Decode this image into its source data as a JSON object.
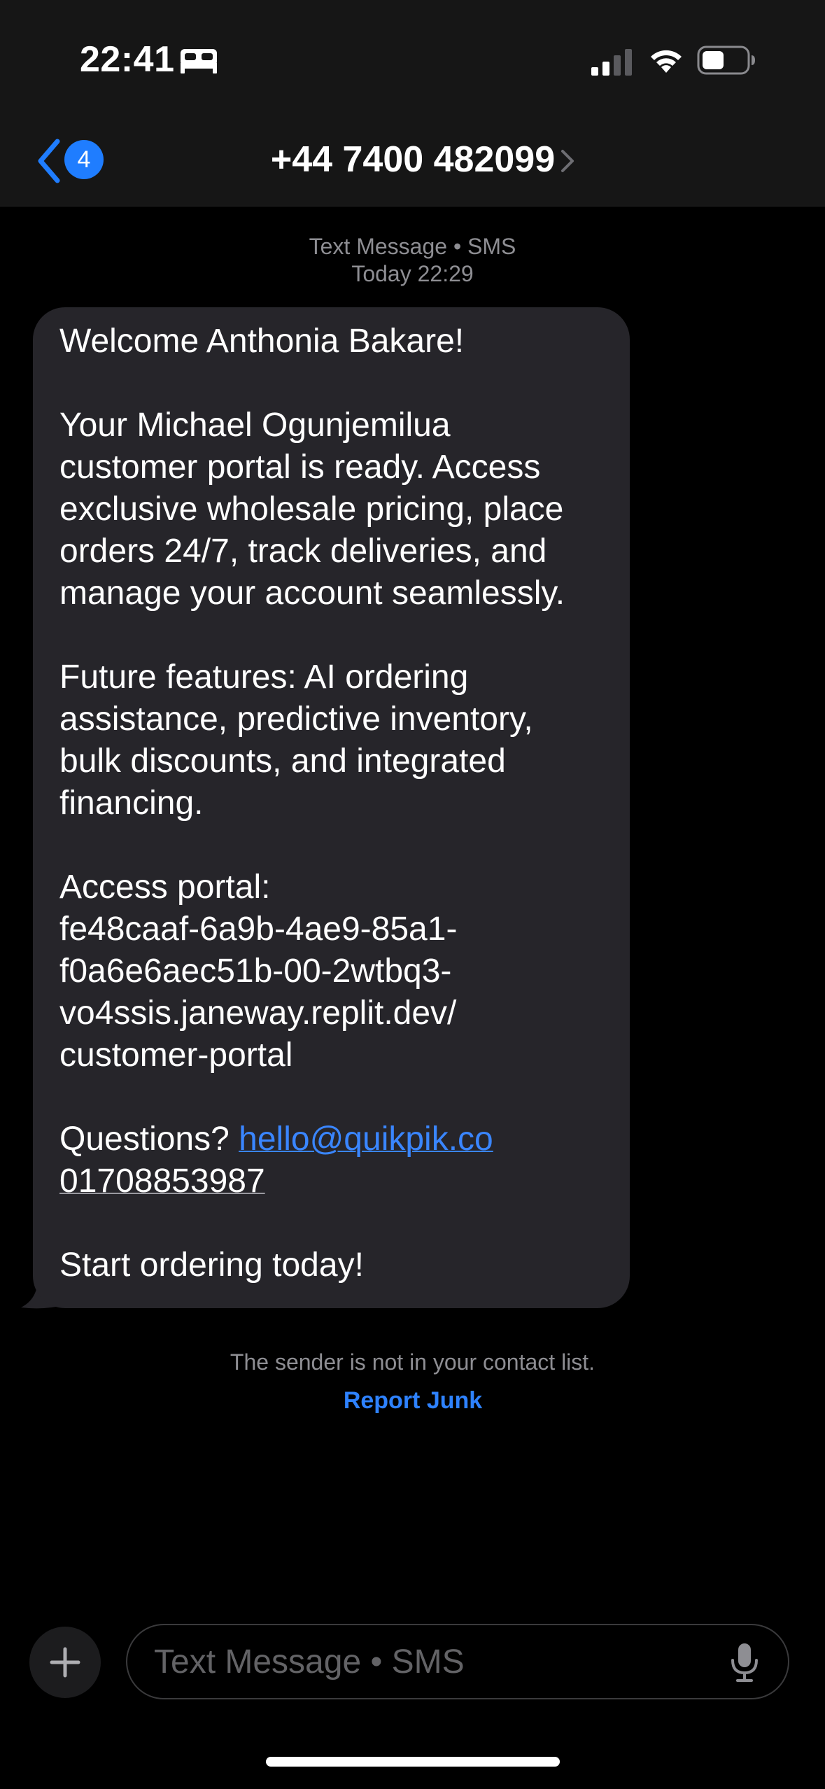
{
  "status_bar": {
    "time": "22:41",
    "focus_icon": "bed-icon",
    "signal_icon": "cellular-signal-icon",
    "wifi_icon": "wifi-icon",
    "battery_icon": "battery-icon"
  },
  "header": {
    "back_badge_count": "4",
    "contact_title": "+44 7400 482099",
    "accent_color": "#1f7dff"
  },
  "conversation": {
    "channel_label": "Text Message • SMS",
    "timestamp": "Today 22:29",
    "message": {
      "line_1": "Welcome Anthonia Bakare!",
      "line_2": "Your Michael Ogunjemilua",
      "line_3": "customer portal is ready. Access",
      "line_4": "exclusive wholesale pricing, place",
      "line_5": "orders 24/7, track deliveries, and",
      "line_6": "manage your account seamlessly.",
      "line_7": "Future features: AI ordering",
      "line_8": "assistance, predictive inventory,",
      "line_9": "bulk discounts, and integrated",
      "line_10": "financing.",
      "line_11": "Access portal:",
      "line_12": "fe48caaf-6a9b-4ae9-85a1-",
      "line_13": "f0a6e6aec51b-00-2wtbq3-",
      "line_14": "vo4ssis.janeway.replit.dev/",
      "line_15": "customer-portal",
      "questions_label": "Questions? ",
      "email_link": "hello@quikpik.co",
      "phone_link": "01708853987",
      "closing": "Start ordering today!"
    },
    "notice": "The sender is not in your contact list.",
    "report_junk": "Report Junk"
  },
  "composer": {
    "placeholder": "Text Message • SMS"
  }
}
